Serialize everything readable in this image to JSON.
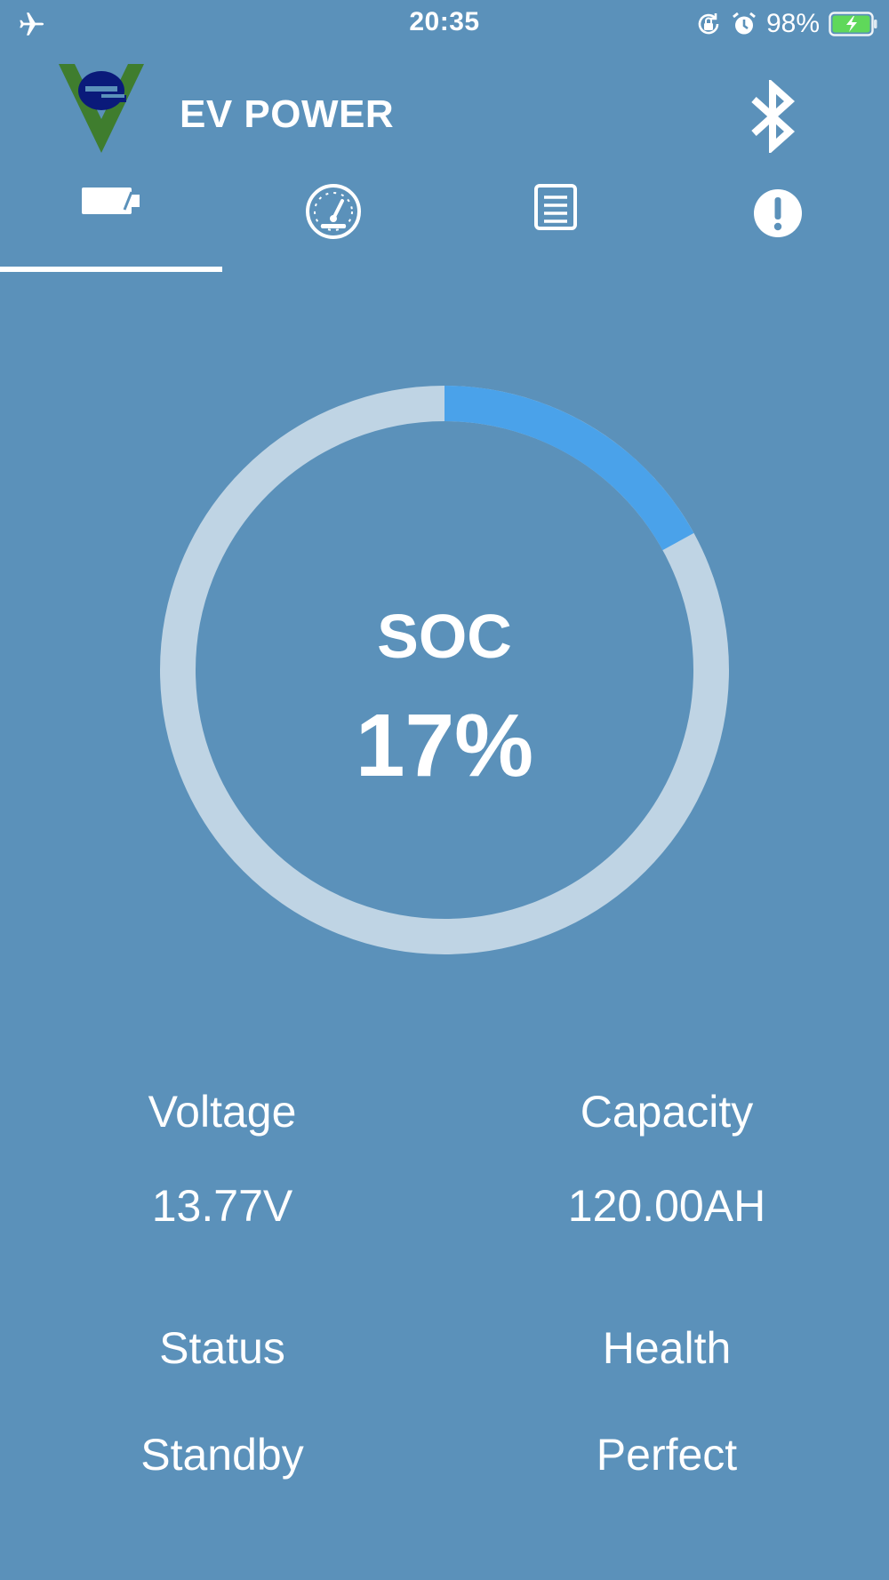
{
  "status_bar": {
    "time": "20:35",
    "battery_percent": "98%",
    "icons": [
      "airplane-icon",
      "rotation-lock-icon",
      "alarm-icon",
      "battery-charging-icon"
    ]
  },
  "header": {
    "title": "EV POWER",
    "logo_icon": "ev-logo",
    "bluetooth_icon": "bluetooth-icon"
  },
  "tabs": [
    {
      "icon": "battery-icon",
      "active": true
    },
    {
      "icon": "gauge-icon",
      "active": false
    },
    {
      "icon": "list-icon",
      "active": false
    },
    {
      "icon": "alert-icon",
      "active": false
    }
  ],
  "soc": {
    "label": "SOC",
    "value_text": "17%",
    "fraction": 0.17
  },
  "metrics": {
    "voltage_label": "Voltage",
    "voltage_value": "13.77V",
    "capacity_label": "Capacity",
    "capacity_value": "120.00AH",
    "status_label": "Status",
    "status_value": "Standby",
    "health_label": "Health",
    "health_value": "Perfect"
  },
  "colors": {
    "background": "#5b91ba",
    "ring_track": "#bfd4e4",
    "ring_fill": "#4aa2ea",
    "logo_green": "#3f7d2e",
    "logo_blue": "#0a1a7a"
  }
}
